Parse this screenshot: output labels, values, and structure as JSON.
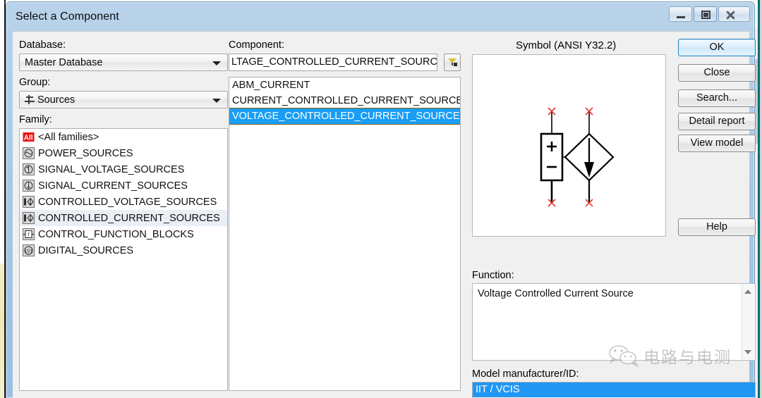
{
  "window": {
    "title": "Select a Component",
    "controls": {
      "minimize": "minimize",
      "restore": "restore",
      "close": "close"
    }
  },
  "left_panel": {
    "database_label": "Database:",
    "database_value": "Master Database",
    "group_label": "Group:",
    "group_value": "Sources",
    "family_label": "Family:",
    "families": [
      {
        "label": "<All families>",
        "icon": "all-families-icon",
        "selected": false
      },
      {
        "label": "POWER_SOURCES",
        "icon": "power-sources-icon",
        "selected": false
      },
      {
        "label": "SIGNAL_VOLTAGE_SOURCES",
        "icon": "signal-voltage-sources-icon",
        "selected": false
      },
      {
        "label": "SIGNAL_CURRENT_SOURCES",
        "icon": "signal-current-sources-icon",
        "selected": false
      },
      {
        "label": "CONTROLLED_VOLTAGE_SOURCES",
        "icon": "controlled-voltage-sources-icon",
        "selected": false
      },
      {
        "label": "CONTROLLED_CURRENT_SOURCES",
        "icon": "controlled-current-sources-icon",
        "selected": true
      },
      {
        "label": "CONTROL_FUNCTION_BLOCKS",
        "icon": "control-function-blocks-icon",
        "selected": false
      },
      {
        "label": "DIGITAL_SOURCES",
        "icon": "digital-sources-icon",
        "selected": false
      }
    ]
  },
  "component_panel": {
    "label": "Component:",
    "search_value": "LTAGE_CONTROLLED_CURRENT_SOURCE",
    "filter_button_icon": "filter-funnel-icon",
    "items": [
      {
        "label": "ABM_CURRENT",
        "selected": false
      },
      {
        "label": "CURRENT_CONTROLLED_CURRENT_SOURCE",
        "selected": false
      },
      {
        "label": "VOLTAGE_CONTROLLED_CURRENT_SOURCE",
        "selected": true
      }
    ]
  },
  "symbol_panel": {
    "title": "Symbol (ANSI Y32.2)",
    "symbol_name": "voltage-controlled-current-source-symbol",
    "plus_sign": "+",
    "minus_sign": "−"
  },
  "buttons": {
    "ok": "OK",
    "close": "Close",
    "search": "Search...",
    "detail_report": "Detail report",
    "view_model": "View model",
    "help": "Help"
  },
  "function_panel": {
    "label": "Function:",
    "value": "Voltage Controlled Current Source"
  },
  "model_panel": {
    "label": "Model manufacturer/ID:",
    "items": [
      {
        "label": "IIT / VCIS",
        "selected": true
      }
    ]
  },
  "watermark": {
    "text": "电路与电测",
    "icon": "wechat-icon"
  },
  "colors": {
    "selection_blue": "#1a9ef5",
    "model_selection_blue": "#2196f3",
    "title_bar": "#b9d3ea",
    "dialog_face": "#f0f0f0",
    "symbol_pin_red": "#e03c31",
    "accent_ok_border": "#2c85c4"
  }
}
